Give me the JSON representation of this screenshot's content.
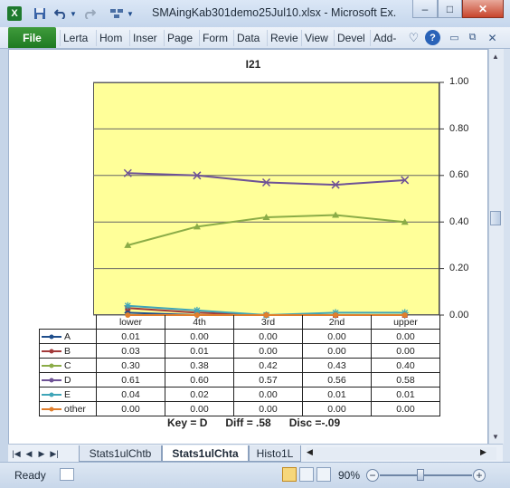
{
  "window": {
    "title": "SMAingKab301demo25Jul10.xlsx - Microsoft Ex...",
    "minimize": "–",
    "maximize": "□",
    "close": "✕"
  },
  "quick_access": {
    "excel_icon": "X",
    "save_icon": "💾",
    "undo_icon": "↶",
    "redo_icon": "↷"
  },
  "ribbon": {
    "file_tab": "File",
    "tabs": [
      "Lerta",
      "Hom",
      "Inser",
      "Page",
      "Form",
      "Data",
      "Revie",
      "View",
      "Devel",
      "Add-"
    ],
    "right_icons": [
      "heart-icon",
      "help-icon",
      "minimize-ribbon-icon",
      "restore-icon",
      "close-workbook-icon"
    ]
  },
  "chart_data": {
    "type": "line",
    "title": "I21",
    "categories": [
      "lower",
      "4th",
      "3rd",
      "2nd",
      "upper"
    ],
    "ylim": [
      0,
      1.0
    ],
    "yticks": [
      "1.00",
      "0.80",
      "0.60",
      "0.40",
      "0.20",
      "0.00"
    ],
    "grid": true,
    "series": [
      {
        "name": "A",
        "values": [
          0.01,
          0.0,
          0.0,
          0.0,
          0.0
        ],
        "display": [
          "0.01",
          "0.00",
          "0.00",
          "0.00",
          "0.00"
        ],
        "color": "#1f4e8c",
        "marker": "diamond"
      },
      {
        "name": "B",
        "values": [
          0.03,
          0.01,
          0.0,
          0.0,
          0.0
        ],
        "display": [
          "0.03",
          "0.01",
          "0.00",
          "0.00",
          "0.00"
        ],
        "color": "#a33a3a",
        "marker": "square"
      },
      {
        "name": "C",
        "values": [
          0.3,
          0.38,
          0.42,
          0.43,
          0.4
        ],
        "display": [
          "0.30",
          "0.38",
          "0.42",
          "0.43",
          "0.40"
        ],
        "color": "#8bac47",
        "marker": "triangle"
      },
      {
        "name": "D",
        "values": [
          0.61,
          0.6,
          0.57,
          0.56,
          0.58
        ],
        "display": [
          "0.61",
          "0.60",
          "0.57",
          "0.56",
          "0.58"
        ],
        "color": "#6e5296",
        "marker": "x"
      },
      {
        "name": "E",
        "values": [
          0.04,
          0.02,
          0.0,
          0.01,
          0.01
        ],
        "display": [
          "0.04",
          "0.02",
          "0.00",
          "0.01",
          "0.01"
        ],
        "color": "#3fa5b8",
        "marker": "star"
      },
      {
        "name": "other",
        "values": [
          0.0,
          0.0,
          0.0,
          0.0,
          0.0
        ],
        "display": [
          "0.00",
          "0.00",
          "0.00",
          "0.00",
          "0.00"
        ],
        "color": "#e07f2d",
        "marker": "circle"
      }
    ]
  },
  "stats": {
    "key": "Key = D",
    "diff": "Diff = .58",
    "disc": "Disc =-.09"
  },
  "sheets": {
    "tabs": [
      "Stats1ulChtb",
      "Stats1ulChta",
      "Histo1L"
    ],
    "active": "Stats1ulChta"
  },
  "status": {
    "ready": "Ready",
    "zoom": "90%",
    "zoom_minus": "−",
    "zoom_plus": "+",
    "zoom_fraction": 0.9
  }
}
